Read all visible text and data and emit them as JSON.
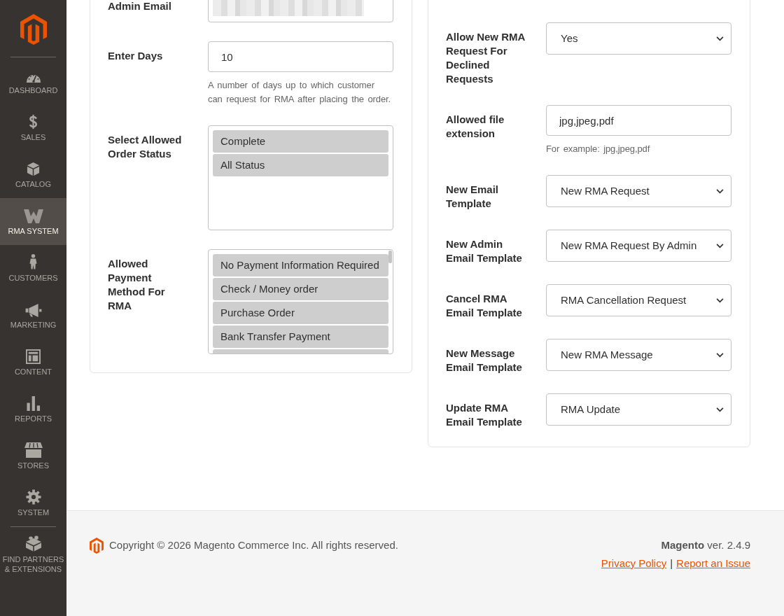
{
  "sidebar": {
    "items": [
      {
        "label": "DASHBOARD",
        "selected": false
      },
      {
        "label": "SALES",
        "selected": false
      },
      {
        "label": "CATALOG",
        "selected": false
      },
      {
        "label": "RMA SYSTEM",
        "selected": true
      },
      {
        "label": "CUSTOMERS",
        "selected": false
      },
      {
        "label": "MARKETING",
        "selected": false
      },
      {
        "label": "CONTENT",
        "selected": false
      },
      {
        "label": "REPORTS",
        "selected": false
      },
      {
        "label": "STORES",
        "selected": false
      },
      {
        "label": "SYSTEM",
        "selected": false
      }
    ],
    "bottom_items": [
      {
        "label": "FIND PARTNERS & EXTENSIONS",
        "selected": false
      }
    ]
  },
  "left_panel": {
    "fields": [
      {
        "kind": "text",
        "label": "Admin Email",
        "blurred_value": true
      },
      {
        "kind": "text",
        "label": "Enter Days",
        "value": "10",
        "note": "A number of days up to which customer can request for RMA after placing the order."
      },
      {
        "kind": "multiselect",
        "label": "Select Allowed Order Status",
        "options": [
          {
            "label": "Complete",
            "selected": true
          },
          {
            "label": "All Status",
            "selected": true
          }
        ]
      },
      {
        "kind": "multiselect",
        "label": "Allowed Payment Method For RMA",
        "options": [
          {
            "label": "No Payment Information Required",
            "selected": true
          },
          {
            "label": "Check / Money order",
            "selected": true
          },
          {
            "label": "Purchase Order",
            "selected": true
          },
          {
            "label": "Bank Transfer Payment",
            "selected": true
          }
        ],
        "partly_hidden_option": {
          "selected": true
        }
      }
    ]
  },
  "right_panel": {
    "fields": [
      {
        "kind": "select",
        "label": "Allow New RMA Request For Declined Requests",
        "value": "Yes"
      },
      {
        "kind": "text",
        "label": "Allowed file extension",
        "value": "jpg,jpeg,pdf",
        "note": "For example: jpg,jpeg,pdf"
      },
      {
        "kind": "select",
        "label": "New Email Template",
        "value": "New RMA Request"
      },
      {
        "kind": "select",
        "label": "New Admin Email Template",
        "value": "New RMA Request By Admin"
      },
      {
        "kind": "select",
        "label": "Cancel RMA Email Template",
        "value": "RMA Cancellation Request"
      },
      {
        "kind": "select",
        "label": "New Message Email Template",
        "value": "New RMA Message"
      },
      {
        "kind": "select",
        "label": "Update RMA Email Template",
        "value": "RMA Update"
      }
    ]
  },
  "footer": {
    "copyright": "Copyright © 2026 Magento Commerce Inc. All rights reserved.",
    "version": "**Magento** ver. 2.4.9",
    "links": [
      "Privacy Policy",
      "Report an Issue"
    ],
    "separator": "|"
  }
}
